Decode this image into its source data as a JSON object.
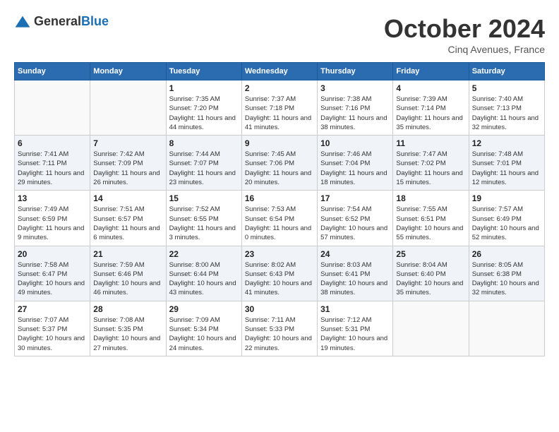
{
  "logo": {
    "text_general": "General",
    "text_blue": "Blue"
  },
  "title": "October 2024",
  "location": "Cinq Avenues, France",
  "days_of_week": [
    "Sunday",
    "Monday",
    "Tuesday",
    "Wednesday",
    "Thursday",
    "Friday",
    "Saturday"
  ],
  "weeks": [
    [
      {
        "day": "",
        "sunrise": "",
        "sunset": "",
        "daylight": ""
      },
      {
        "day": "",
        "sunrise": "",
        "sunset": "",
        "daylight": ""
      },
      {
        "day": "1",
        "sunrise": "Sunrise: 7:35 AM",
        "sunset": "Sunset: 7:20 PM",
        "daylight": "Daylight: 11 hours and 44 minutes."
      },
      {
        "day": "2",
        "sunrise": "Sunrise: 7:37 AM",
        "sunset": "Sunset: 7:18 PM",
        "daylight": "Daylight: 11 hours and 41 minutes."
      },
      {
        "day": "3",
        "sunrise": "Sunrise: 7:38 AM",
        "sunset": "Sunset: 7:16 PM",
        "daylight": "Daylight: 11 hours and 38 minutes."
      },
      {
        "day": "4",
        "sunrise": "Sunrise: 7:39 AM",
        "sunset": "Sunset: 7:14 PM",
        "daylight": "Daylight: 11 hours and 35 minutes."
      },
      {
        "day": "5",
        "sunrise": "Sunrise: 7:40 AM",
        "sunset": "Sunset: 7:13 PM",
        "daylight": "Daylight: 11 hours and 32 minutes."
      }
    ],
    [
      {
        "day": "6",
        "sunrise": "Sunrise: 7:41 AM",
        "sunset": "Sunset: 7:11 PM",
        "daylight": "Daylight: 11 hours and 29 minutes."
      },
      {
        "day": "7",
        "sunrise": "Sunrise: 7:42 AM",
        "sunset": "Sunset: 7:09 PM",
        "daylight": "Daylight: 11 hours and 26 minutes."
      },
      {
        "day": "8",
        "sunrise": "Sunrise: 7:44 AM",
        "sunset": "Sunset: 7:07 PM",
        "daylight": "Daylight: 11 hours and 23 minutes."
      },
      {
        "day": "9",
        "sunrise": "Sunrise: 7:45 AM",
        "sunset": "Sunset: 7:06 PM",
        "daylight": "Daylight: 11 hours and 20 minutes."
      },
      {
        "day": "10",
        "sunrise": "Sunrise: 7:46 AM",
        "sunset": "Sunset: 7:04 PM",
        "daylight": "Daylight: 11 hours and 18 minutes."
      },
      {
        "day": "11",
        "sunrise": "Sunrise: 7:47 AM",
        "sunset": "Sunset: 7:02 PM",
        "daylight": "Daylight: 11 hours and 15 minutes."
      },
      {
        "day": "12",
        "sunrise": "Sunrise: 7:48 AM",
        "sunset": "Sunset: 7:01 PM",
        "daylight": "Daylight: 11 hours and 12 minutes."
      }
    ],
    [
      {
        "day": "13",
        "sunrise": "Sunrise: 7:49 AM",
        "sunset": "Sunset: 6:59 PM",
        "daylight": "Daylight: 11 hours and 9 minutes."
      },
      {
        "day": "14",
        "sunrise": "Sunrise: 7:51 AM",
        "sunset": "Sunset: 6:57 PM",
        "daylight": "Daylight: 11 hours and 6 minutes."
      },
      {
        "day": "15",
        "sunrise": "Sunrise: 7:52 AM",
        "sunset": "Sunset: 6:55 PM",
        "daylight": "Daylight: 11 hours and 3 minutes."
      },
      {
        "day": "16",
        "sunrise": "Sunrise: 7:53 AM",
        "sunset": "Sunset: 6:54 PM",
        "daylight": "Daylight: 11 hours and 0 minutes."
      },
      {
        "day": "17",
        "sunrise": "Sunrise: 7:54 AM",
        "sunset": "Sunset: 6:52 PM",
        "daylight": "Daylight: 10 hours and 57 minutes."
      },
      {
        "day": "18",
        "sunrise": "Sunrise: 7:55 AM",
        "sunset": "Sunset: 6:51 PM",
        "daylight": "Daylight: 10 hours and 55 minutes."
      },
      {
        "day": "19",
        "sunrise": "Sunrise: 7:57 AM",
        "sunset": "Sunset: 6:49 PM",
        "daylight": "Daylight: 10 hours and 52 minutes."
      }
    ],
    [
      {
        "day": "20",
        "sunrise": "Sunrise: 7:58 AM",
        "sunset": "Sunset: 6:47 PM",
        "daylight": "Daylight: 10 hours and 49 minutes."
      },
      {
        "day": "21",
        "sunrise": "Sunrise: 7:59 AM",
        "sunset": "Sunset: 6:46 PM",
        "daylight": "Daylight: 10 hours and 46 minutes."
      },
      {
        "day": "22",
        "sunrise": "Sunrise: 8:00 AM",
        "sunset": "Sunset: 6:44 PM",
        "daylight": "Daylight: 10 hours and 43 minutes."
      },
      {
        "day": "23",
        "sunrise": "Sunrise: 8:02 AM",
        "sunset": "Sunset: 6:43 PM",
        "daylight": "Daylight: 10 hours and 41 minutes."
      },
      {
        "day": "24",
        "sunrise": "Sunrise: 8:03 AM",
        "sunset": "Sunset: 6:41 PM",
        "daylight": "Daylight: 10 hours and 38 minutes."
      },
      {
        "day": "25",
        "sunrise": "Sunrise: 8:04 AM",
        "sunset": "Sunset: 6:40 PM",
        "daylight": "Daylight: 10 hours and 35 minutes."
      },
      {
        "day": "26",
        "sunrise": "Sunrise: 8:05 AM",
        "sunset": "Sunset: 6:38 PM",
        "daylight": "Daylight: 10 hours and 32 minutes."
      }
    ],
    [
      {
        "day": "27",
        "sunrise": "Sunrise: 7:07 AM",
        "sunset": "Sunset: 5:37 PM",
        "daylight": "Daylight: 10 hours and 30 minutes."
      },
      {
        "day": "28",
        "sunrise": "Sunrise: 7:08 AM",
        "sunset": "Sunset: 5:35 PM",
        "daylight": "Daylight: 10 hours and 27 minutes."
      },
      {
        "day": "29",
        "sunrise": "Sunrise: 7:09 AM",
        "sunset": "Sunset: 5:34 PM",
        "daylight": "Daylight: 10 hours and 24 minutes."
      },
      {
        "day": "30",
        "sunrise": "Sunrise: 7:11 AM",
        "sunset": "Sunset: 5:33 PM",
        "daylight": "Daylight: 10 hours and 22 minutes."
      },
      {
        "day": "31",
        "sunrise": "Sunrise: 7:12 AM",
        "sunset": "Sunset: 5:31 PM",
        "daylight": "Daylight: 10 hours and 19 minutes."
      },
      {
        "day": "",
        "sunrise": "",
        "sunset": "",
        "daylight": ""
      },
      {
        "day": "",
        "sunrise": "",
        "sunset": "",
        "daylight": ""
      }
    ]
  ]
}
